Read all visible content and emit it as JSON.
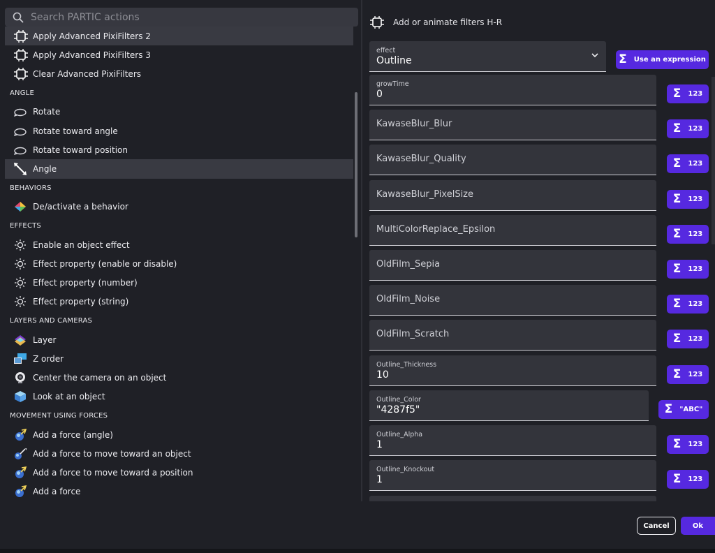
{
  "search": {
    "placeholder": "Search PARTIC actions"
  },
  "header": {
    "title": "Add or animate filters H-R"
  },
  "list": [
    {
      "kind": "item",
      "label": "Apply Advanced PixiFilters 2",
      "icon": "pixifilter-icon",
      "selected": true
    },
    {
      "kind": "item",
      "label": "Apply Advanced PixiFilters 3",
      "icon": "pixifilter-icon"
    },
    {
      "kind": "item",
      "label": "Clear Advanced PixiFilters",
      "icon": "pixifilter-icon"
    },
    {
      "kind": "cat",
      "label": "ANGLE"
    },
    {
      "kind": "item",
      "label": "Rotate",
      "icon": "rotate-icon"
    },
    {
      "kind": "item",
      "label": "Rotate toward angle",
      "icon": "rotate-icon"
    },
    {
      "kind": "item",
      "label": "Rotate toward position",
      "icon": "rotate-icon"
    },
    {
      "kind": "item",
      "label": "Angle",
      "icon": "angle-icon",
      "selected": true
    },
    {
      "kind": "cat",
      "label": "BEHAVIORS"
    },
    {
      "kind": "item",
      "label": "De/activate a behavior",
      "icon": "behavior-icon"
    },
    {
      "kind": "cat",
      "label": "EFFECTS"
    },
    {
      "kind": "item",
      "label": "Enable an object effect",
      "icon": "effect-icon"
    },
    {
      "kind": "item",
      "label": "Effect property (enable or disable)",
      "icon": "effect-icon"
    },
    {
      "kind": "item",
      "label": "Effect property (number)",
      "icon": "effect-icon"
    },
    {
      "kind": "item",
      "label": "Effect property (string)",
      "icon": "effect-icon"
    },
    {
      "kind": "cat",
      "label": "LAYERS AND CAMERAS"
    },
    {
      "kind": "item",
      "label": "Layer",
      "icon": "layer-icon"
    },
    {
      "kind": "item",
      "label": "Z order",
      "icon": "z-order-icon"
    },
    {
      "kind": "item",
      "label": "Center the camera on an object",
      "icon": "camera-icon"
    },
    {
      "kind": "item",
      "label": "Look at an object",
      "icon": "cube-icon"
    },
    {
      "kind": "cat",
      "label": "MOVEMENT USING FORCES"
    },
    {
      "kind": "item",
      "label": "Add a force (angle)",
      "icon": "force-icon"
    },
    {
      "kind": "item",
      "label": "Add a force to move toward an object",
      "icon": "force-object-icon"
    },
    {
      "kind": "item",
      "label": "Add a force to move toward a position",
      "icon": "force-icon"
    },
    {
      "kind": "item",
      "label": "Add a force",
      "icon": "force-icon"
    }
  ],
  "effect": {
    "label": "effect",
    "value": "Outline",
    "expr_button": "Use an expression"
  },
  "fields": [
    {
      "label": "growTime",
      "value": "0",
      "type": "123"
    },
    {
      "label": "",
      "placeholder": "KawaseBlur_Blur",
      "type": "123"
    },
    {
      "label": "",
      "placeholder": "KawaseBlur_Quality",
      "type": "123"
    },
    {
      "label": "",
      "placeholder": "KawaseBlur_PixelSize",
      "type": "123"
    },
    {
      "label": "",
      "placeholder": "MultiColorReplace_Epsilon",
      "type": "123"
    },
    {
      "label": "",
      "placeholder": "OldFilm_Sepia",
      "type": "123"
    },
    {
      "label": "",
      "placeholder": "OldFilm_Noise",
      "type": "123"
    },
    {
      "label": "",
      "placeholder": "OldFilm_Scratch",
      "type": "123"
    },
    {
      "label": "Outline_Thickness",
      "value": "10",
      "type": "123"
    },
    {
      "label": "Outline_Color",
      "value": "\"4287f5\"",
      "type": "\"ABC\""
    },
    {
      "label": "Outline_Alpha",
      "value": "1",
      "type": "123"
    },
    {
      "label": "Outline_Knockout",
      "value": "1",
      "type": "123"
    }
  ],
  "footer": {
    "cancel": "Cancel",
    "ok": "Ok"
  },
  "colors": {
    "accent": "#5629e0",
    "bg": "#1f2026",
    "field": "#33343b",
    "selected": "#393a42"
  }
}
